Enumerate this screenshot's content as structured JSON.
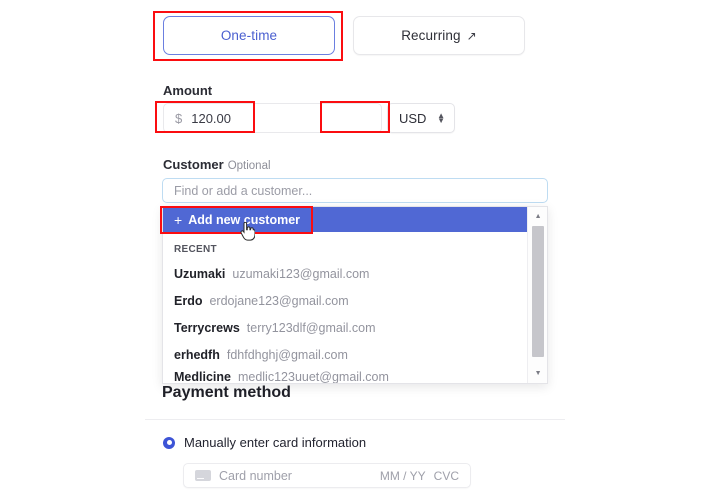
{
  "tabs": [
    {
      "label": "One-time",
      "state": "active",
      "icon": ""
    },
    {
      "label": "Recurring",
      "state": "inactive",
      "icon": "external-link-arrow"
    }
  ],
  "amount": {
    "label": "Amount",
    "currency_symbol": "$",
    "value": "120.00",
    "currency": "USD",
    "selector_icon": "chevron-up-down-icon"
  },
  "customer": {
    "label": "Customer",
    "optional_text": "Optional",
    "input_placeholder": "Find or add a customer...",
    "input_value": "",
    "dropdown": {
      "add_new_label": "Add new customer",
      "add_new_plus": "+",
      "section_header": "RECENT",
      "items": [
        {
          "name": "Uzumaki",
          "email": "uzumaki123@gmail.com"
        },
        {
          "name": "Erdo",
          "email": "erdojane123@gmail.com"
        },
        {
          "name": "Terrycrews",
          "email": "terry123dlf@gmail.com"
        },
        {
          "name": "erhedfh",
          "email": "fdhfdhghj@gmail.com"
        },
        {
          "name": "Medlicine",
          "email": "medlic123uuet@gmail.com"
        }
      ],
      "scrollbar": {
        "up_icon": "caret-up-icon",
        "down_icon": "caret-down-icon"
      }
    }
  },
  "payment_method": {
    "title": "Payment method",
    "manual_option_label": "Manually enter card information",
    "card": {
      "icon": "credit-card-icon",
      "number_placeholder": "Card number",
      "expiry_placeholder": "MM / YY",
      "cvc_placeholder": "CVC"
    }
  },
  "colors": {
    "accent_blue": "#5068d4",
    "tab_active_border": "#6b7fe0",
    "tab_active_text": "#4a5fd0",
    "input_focus_border": "#bedcf2",
    "annotation_red": "#fb0d10",
    "radio_blue": "#3d54d6"
  },
  "annotations": [
    {
      "name": "one-time-tab-highlight"
    },
    {
      "name": "amount-field-highlight"
    },
    {
      "name": "currency-select-highlight"
    },
    {
      "name": "add-new-customer-highlight"
    }
  ]
}
